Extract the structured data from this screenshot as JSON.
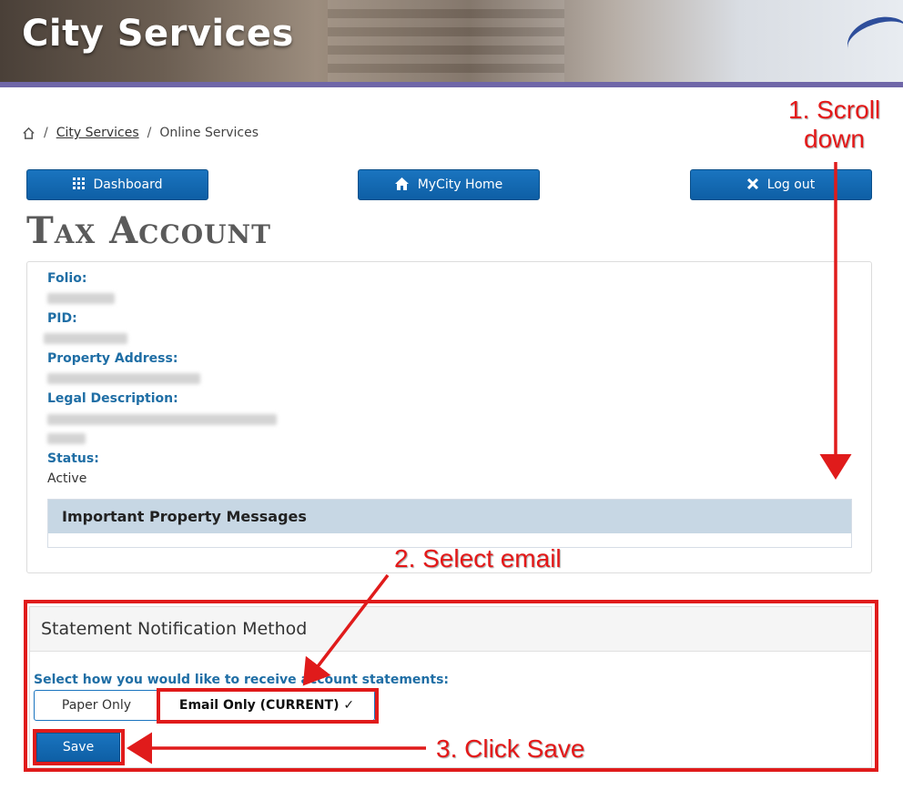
{
  "header": {
    "site_title": "City Services"
  },
  "breadcrumb": {
    "home_icon": "home-icon",
    "separator": "/",
    "items": [
      "City Services",
      "Online Services"
    ]
  },
  "nav_buttons": {
    "dashboard": {
      "label": "Dashboard",
      "icon": "grid-icon"
    },
    "home": {
      "label": "MyCity Home",
      "icon": "house-icon"
    },
    "logout": {
      "label": "Log out",
      "icon": "close-icon"
    }
  },
  "page": {
    "title": "Tax Account"
  },
  "account": {
    "folio_label": "Folio:",
    "pid_label": "PID:",
    "address_label": "Property Address:",
    "legal_label": "Legal Description:",
    "status_label": "Status:",
    "status_value": "Active",
    "messages_heading": "Important Property Messages"
  },
  "notification": {
    "heading": "Statement Notification Method",
    "prompt": "Select how you would like to receive account statements:",
    "options": [
      "Paper Only",
      "Email Only (CURRENT) ✓"
    ],
    "selected": "Email Only (CURRENT) ✓",
    "save_label": "Save"
  },
  "annotations": {
    "step1": [
      "1. Scroll",
      "down"
    ],
    "step2": "2. Select email",
    "step3": "3. Click Save",
    "color": "#e01b1b"
  },
  "colors": {
    "primary_button": "#1a74bf",
    "label_blue": "#1f6ea5",
    "banner_accent": "#6f66a8"
  }
}
